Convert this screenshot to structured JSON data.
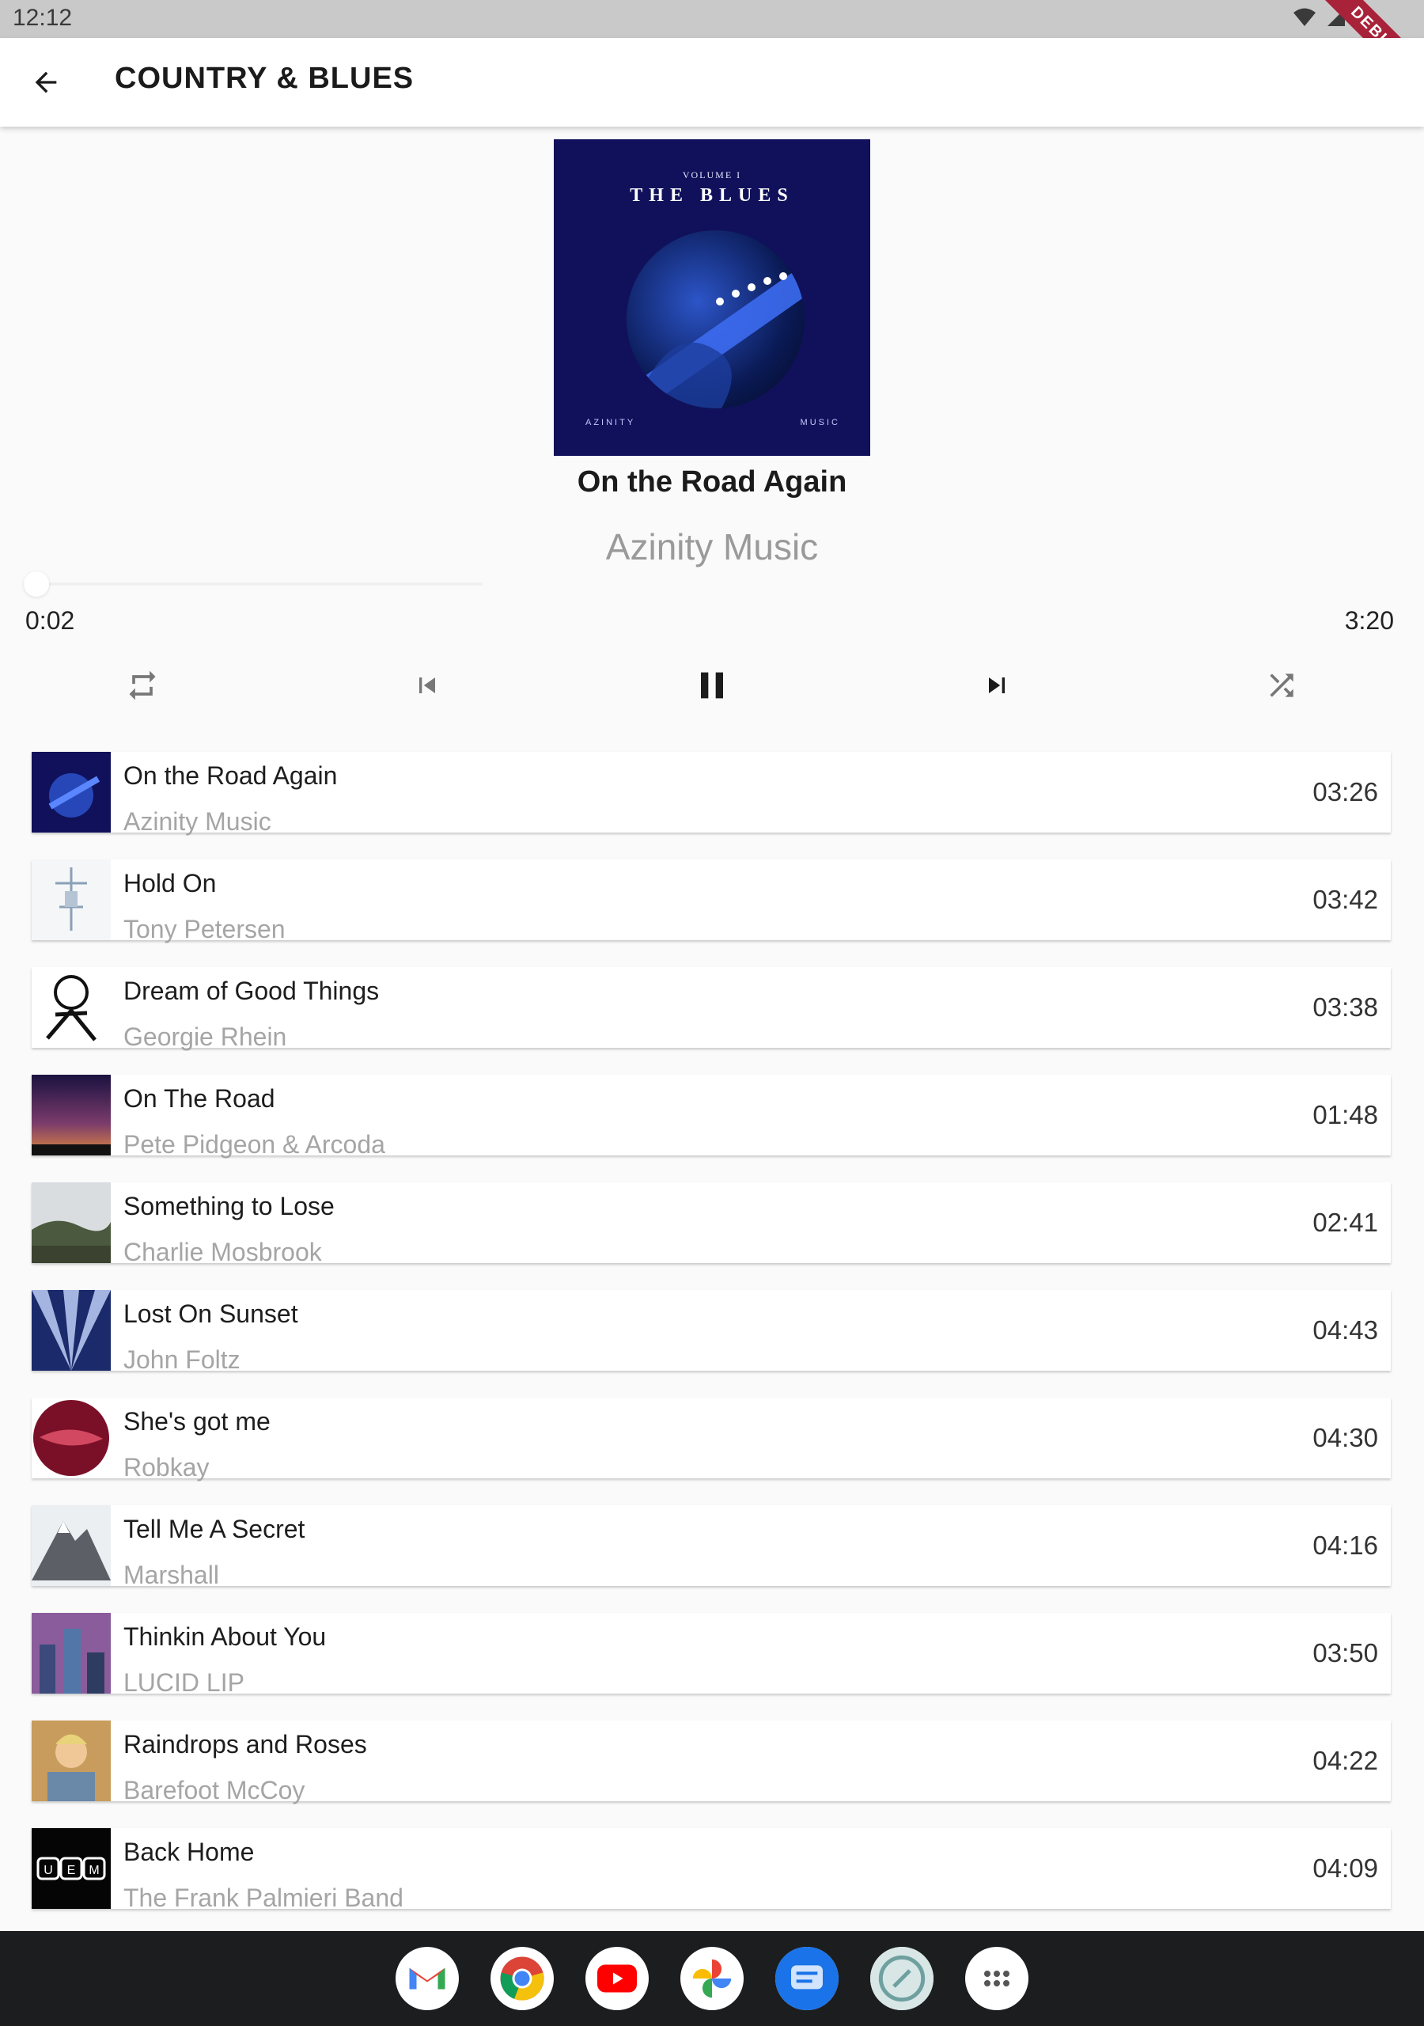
{
  "status_bar": {
    "time": "12:12",
    "debug_label": "DEBUG"
  },
  "app_bar": {
    "title": "COUNTRY & BLUES"
  },
  "now_playing": {
    "cover": {
      "volume": "VOLUME I",
      "title": "THE BLUES",
      "left": "AZINITY",
      "right": "MUSIC"
    },
    "title": "On the Road Again",
    "artist": "Azinity Music",
    "position": "0:02",
    "duration": "3:20",
    "progress_fraction": 0.01
  },
  "controls": {
    "repeat": "repeat-icon",
    "previous": "skip-previous-icon",
    "play_pause": "pause-icon",
    "next": "skip-next-icon",
    "shuffle": "shuffle-icon"
  },
  "tracks": [
    {
      "title": "On the Road Again",
      "artist": "Azinity Music",
      "duration": "03:26",
      "art": "blues-cover"
    },
    {
      "title": "Hold On",
      "artist": "Tony Petersen",
      "duration": "03:42",
      "art": "light-sketch"
    },
    {
      "title": "Dream of Good Things",
      "artist": "Georgie Rhein",
      "duration": "03:38",
      "art": "cartoon"
    },
    {
      "title": "On The Road",
      "artist": "Pete Pidgeon & Arcoda",
      "duration": "01:48",
      "art": "night-sky"
    },
    {
      "title": "Something to Lose",
      "artist": "Charlie Mosbrook",
      "duration": "02:41",
      "art": "landscape"
    },
    {
      "title": "Lost On Sunset",
      "artist": "John Foltz",
      "duration": "04:43",
      "art": "light-rays"
    },
    {
      "title": "She's got me",
      "artist": "Robkay",
      "duration": "04:30",
      "art": "red-circle"
    },
    {
      "title": "Tell Me A Secret",
      "artist": "Marshall",
      "duration": "04:16",
      "art": "mountain"
    },
    {
      "title": "Thinkin About You",
      "artist": "LUCID LIP",
      "duration": "03:50",
      "art": "city"
    },
    {
      "title": "Raindrops and Roses",
      "artist": "Barefoot McCoy",
      "duration": "04:22",
      "art": "portrait"
    },
    {
      "title": "Back Home",
      "artist": "The Frank Palmieri Band",
      "duration": "04:09",
      "art": "uem-logo"
    }
  ],
  "dock": {
    "apps": [
      "gmail-icon",
      "chrome-icon",
      "youtube-icon",
      "photos-icon",
      "messages-icon",
      "files-icon",
      "app-drawer-icon"
    ]
  },
  "colors": {
    "accent": "#1b1b1b",
    "muted_text": "#a5a5a5",
    "cover_bg": "#10115a"
  }
}
